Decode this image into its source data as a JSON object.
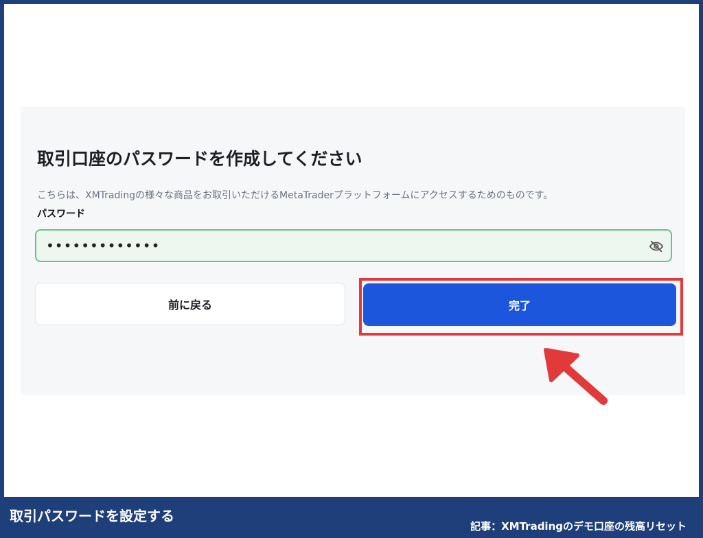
{
  "form": {
    "title": "取引口座のパスワードを作成してください",
    "description": "こちらは、XMTradingの様々な商品をお取引いただけるMetaTraderプラットフォームにアクセスするためのものです。",
    "password_label": "パスワード",
    "password_value": "•••••••••••••",
    "visibility_icon": "eye-slash-icon",
    "back_label": "前に戻る",
    "done_label": "完了"
  },
  "annotation": {
    "highlight_color": "#e23a3a",
    "arrow_icon": "arrow-up-left-icon"
  },
  "footer": {
    "caption": "取引パスワードを設定する",
    "source": "記事：XMTradingのデモ口座の残高リセット"
  },
  "colors": {
    "primary": "#1b56dc",
    "field_border": "#6cc18a",
    "frame": "#1f3f7a"
  }
}
